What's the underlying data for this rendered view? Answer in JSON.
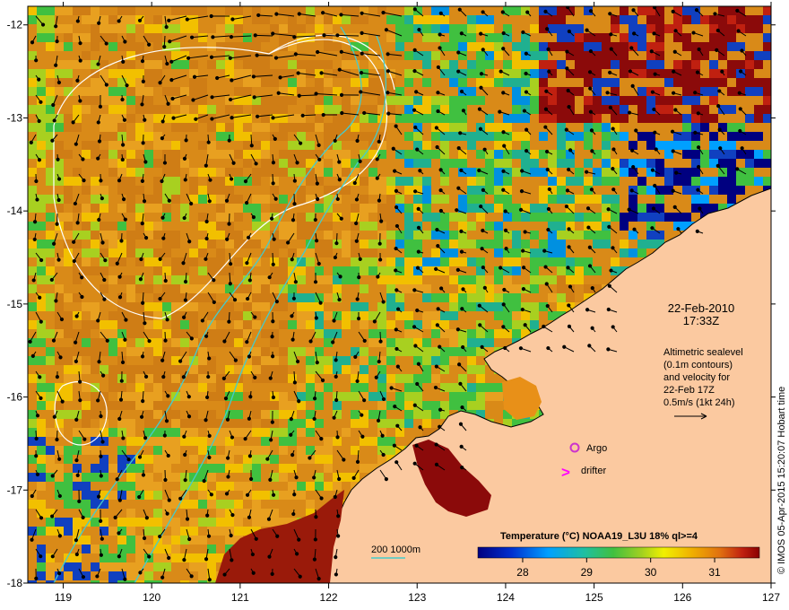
{
  "map": {
    "date": "22-Feb-2010",
    "time": "17:33Z",
    "info_lines": [
      "Altimetric sealevel",
      "(0.1m contours)",
      "and velocity for",
      "22-Feb 17Z",
      "0.5m/s (1kt 24h)"
    ],
    "credit": "© IMOS 05-Apr-2015 15:20:07 Hobart time",
    "x_ticks": [
      "119",
      "120",
      "121",
      "122",
      "123",
      "124",
      "125",
      "126",
      "127"
    ],
    "y_ticks": [
      "-12",
      "-13",
      "-14",
      "-15",
      "-16",
      "-17",
      "-18"
    ],
    "x_range": [
      118.6,
      127.0
    ],
    "y_range": [
      -18.0,
      -11.8
    ],
    "legend": {
      "argo": "Argo",
      "drifter": "drifter",
      "drifter_marker": ">",
      "bathy": "200  1000m"
    },
    "colorbar": {
      "title": "Temperature (°C) NOAA19_L3U 18% ql>=4",
      "ticks": [
        "28",
        "29",
        "30",
        "31"
      ],
      "tick_values": [
        28,
        29,
        30,
        31
      ],
      "range": [
        27.3,
        31.7
      ]
    },
    "colors": {
      "land": "#fbc9a0",
      "argo": "#cc33cc",
      "drifter": "#ff00ff",
      "bathy": "#44cccc",
      "contour": "#ffffff",
      "arrow": "#000000"
    }
  }
}
